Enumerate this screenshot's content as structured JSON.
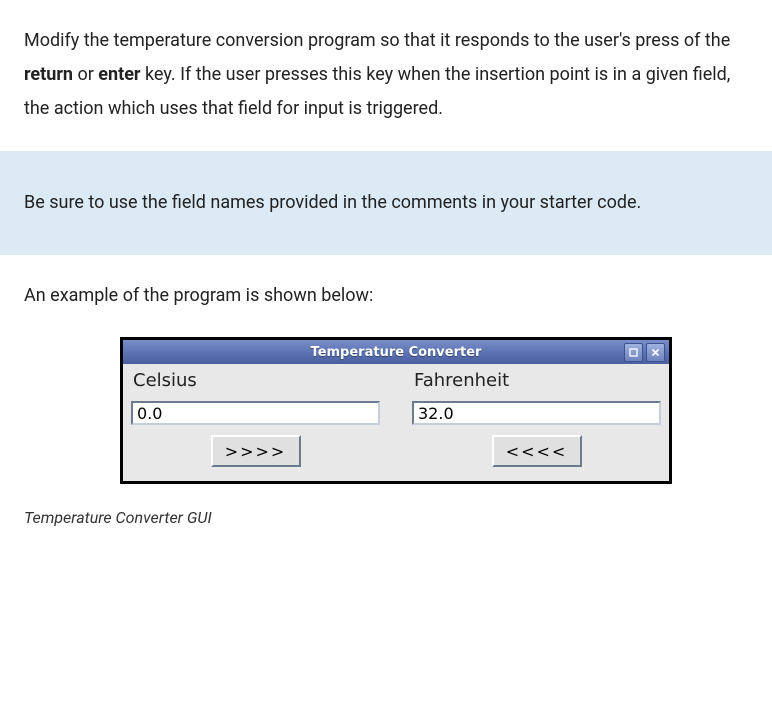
{
  "instructions": {
    "p1_pre": "Modify the temperature conversion program so that it responds to the user's press of the ",
    "kw_return": "return",
    "p1_mid": " or ",
    "kw_enter": "enter",
    "p1_post": " key. If the user presses this key when the insertion point is in a given field, the action which uses that field for input is triggered."
  },
  "note": "Be sure to use the field names provided in the comments in your starter code.",
  "example_intro": "An example of the program is shown below:",
  "window": {
    "title": "Temperature Converter",
    "celsius_label": "Celsius",
    "fahrenheit_label": "Fahrenheit",
    "celsius_value": "0.0",
    "fahrenheit_value": "32.0",
    "to_f_button": ">>>>",
    "to_c_button": "<<<<"
  },
  "caption": "Temperature Converter GUI"
}
